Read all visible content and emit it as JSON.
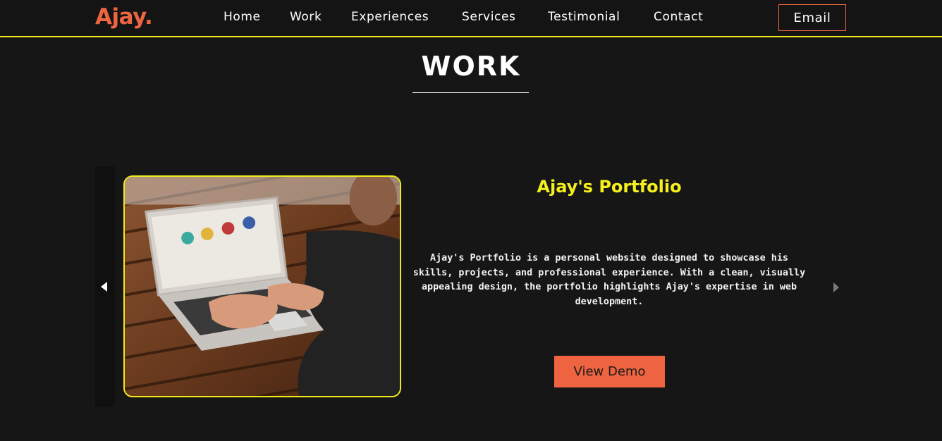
{
  "brand": {
    "logo": "Ajay."
  },
  "nav": {
    "links": [
      "Home",
      "Work",
      "Experiences",
      "Services",
      "Testimonial",
      "Contact"
    ],
    "email_label": "Email"
  },
  "section": {
    "title": "WORK"
  },
  "project": {
    "title": "Ajay's Portfolio",
    "description": "Ajay's Portfolio is a personal website designed to showcase his skills, projects, and professional experience. With a clean, visually appealing design, the portfolio highlights Ajay's expertise in web development.",
    "cta_label": "View Demo"
  },
  "colors": {
    "background": "#161616",
    "accent": "#ee6541",
    "highlight": "#f0ea1c"
  }
}
